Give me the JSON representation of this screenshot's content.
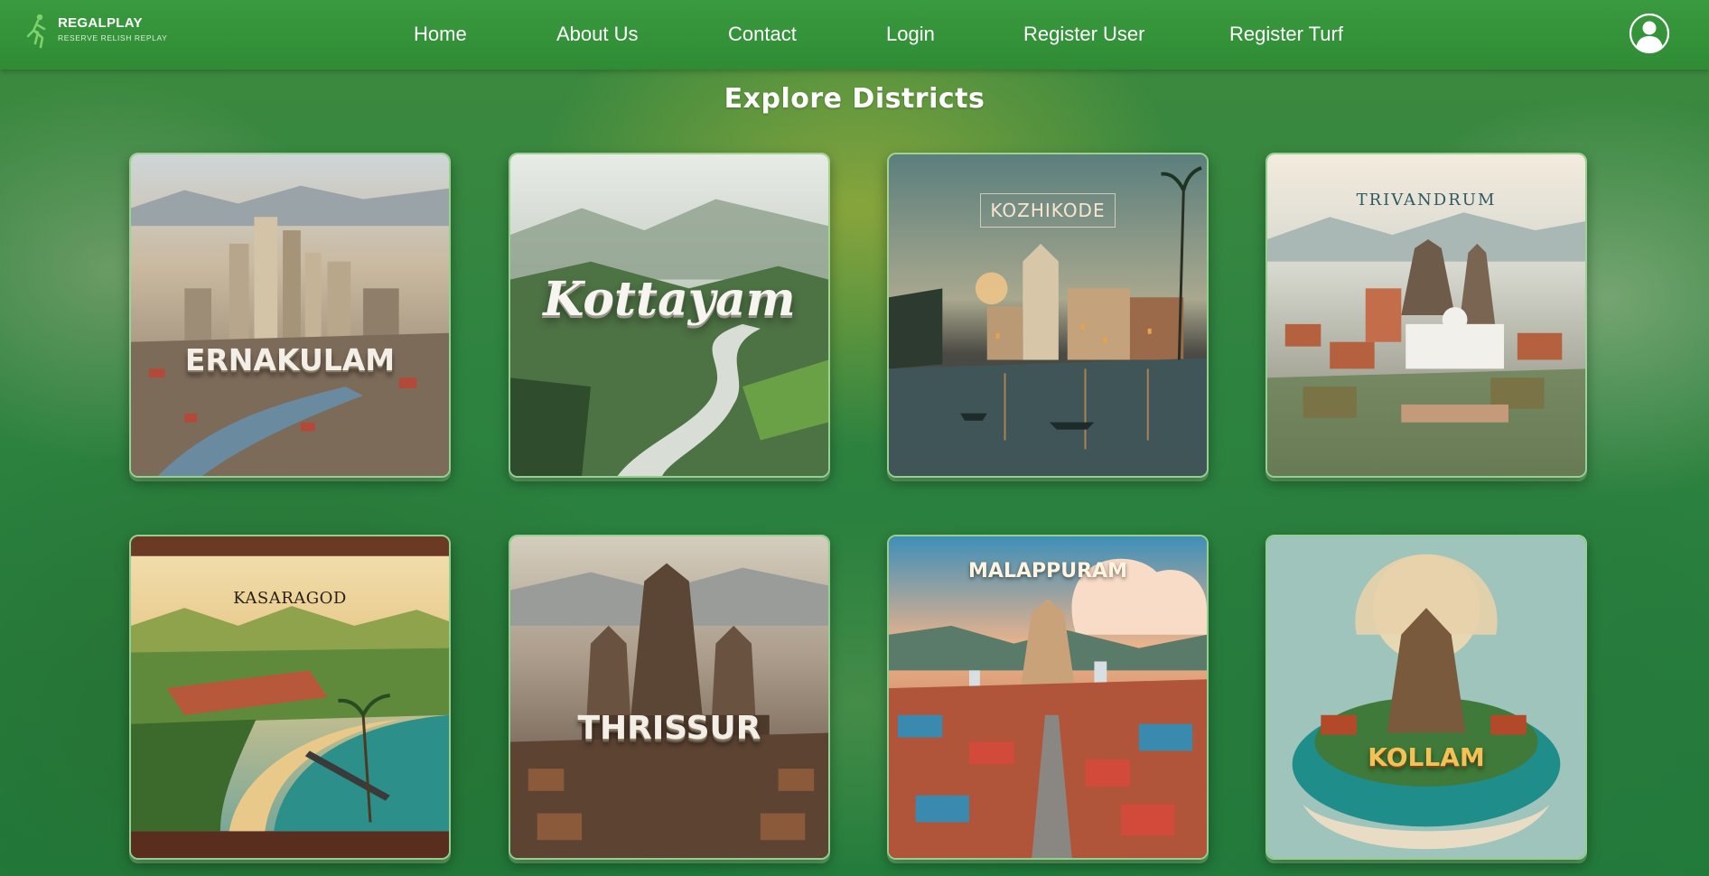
{
  "brand": {
    "name": "REGALPLAY",
    "tagline": "RESERVE RELISH REPLAY"
  },
  "nav": {
    "items": [
      {
        "label": "Home"
      },
      {
        "label": "About Us"
      },
      {
        "label": "Contact"
      },
      {
        "label": "Login"
      },
      {
        "label": "Register User"
      },
      {
        "label": "Register Turf"
      }
    ],
    "user_icon": "user-circle-icon"
  },
  "page": {
    "title": "Explore Districts"
  },
  "districts": [
    {
      "name": "ERNAKULAM"
    },
    {
      "name": "Kottayam"
    },
    {
      "name": "KOZHIKODE"
    },
    {
      "name": "TRIVANDRUM"
    },
    {
      "name": "KASARAGOD"
    },
    {
      "name": "THRISSUR"
    },
    {
      "name": "MALAPPURAM"
    },
    {
      "name": "KOLLAM"
    }
  ],
  "colors": {
    "navbar": "#2f8c35",
    "background": "#2a7a3a",
    "text": "#ffffff"
  }
}
